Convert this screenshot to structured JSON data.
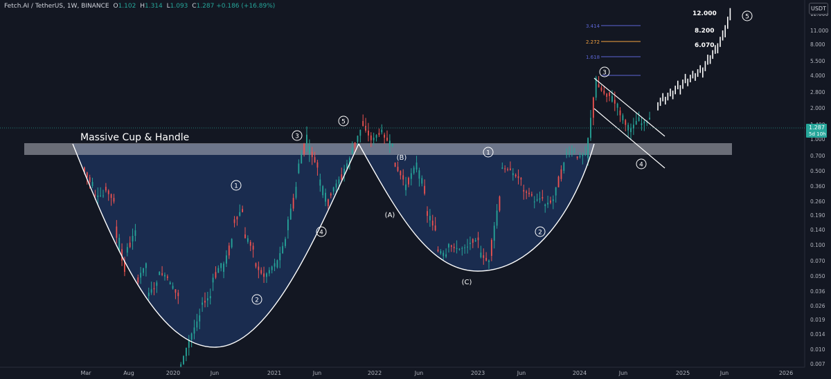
{
  "header": {
    "symbol": "Fetch.AI / TetherUS, 1W, BINANCE",
    "o_label": "O",
    "o_value": "1.102",
    "h_label": "H",
    "h_value": "1.314",
    "l_label": "L",
    "l_value": "1.093",
    "c_label": "C",
    "c_value": "1.287",
    "change": "+0.186 (+16.89%)"
  },
  "currency": "USDT",
  "colors": {
    "background": "#131722",
    "up": "#26a69a",
    "down": "#ef5350",
    "cup_fill": "#1c3057",
    "zone": "#b2b5be",
    "text": "#d1d4dc",
    "line": "#ffffff"
  },
  "chart_data": {
    "type": "candlestick",
    "title": "Massive Cup & Handle",
    "y_scale": "log",
    "y_ticks": [
      "12.000",
      "11.000",
      "8.000",
      "5.500",
      "4.000",
      "2.800",
      "2.000",
      "1.400",
      "1.000",
      "0.700",
      "0.500",
      "0.360",
      "0.260",
      "0.190",
      "0.140",
      "0.100",
      "0.070",
      "0.050",
      "0.036",
      "0.026",
      "0.019",
      "0.014",
      "0.010",
      "0.007"
    ],
    "x_ticks": [
      "Mar",
      "Aug",
      "2020",
      "Jun",
      "2021",
      "Jun",
      "2022",
      "Jun",
      "2023",
      "Jun",
      "2024",
      "Jun",
      "2025",
      "Jun",
      "2026"
    ],
    "last_price": "1.287",
    "countdown": "5d 10h",
    "fib_levels": [
      {
        "label": "3.414",
        "color": "#5d66d6"
      },
      {
        "label": "2.272",
        "color": "#f7a440"
      },
      {
        "label": "1.618",
        "color": "#5d66d6"
      }
    ],
    "targets": [
      "12.000",
      "8.200",
      "6.070"
    ],
    "wave_labels": [
      "1",
      "2",
      "3",
      "4",
      "5",
      "1",
      "2",
      "3",
      "4",
      "5",
      "1",
      "2",
      "3",
      "4",
      "5"
    ],
    "abc_labels": [
      "(A)",
      "(B)",
      "(C)"
    ],
    "price_path": [
      [
        0.45,
        0.3
      ],
      [
        0.25,
        0.25
      ],
      [
        0.3,
        0.22
      ],
      [
        0.13,
        0.05
      ],
      [
        0.075,
        0.12
      ],
      [
        0.04,
        0.06
      ],
      [
        0.03,
        0.04
      ],
      [
        0.05,
        0.044
      ],
      [
        0.04,
        0.03
      ],
      [
        0.006,
        0.012
      ],
      [
        0.012,
        0.02
      ],
      [
        0.025,
        0.03
      ],
      [
        0.04,
        0.06
      ],
      [
        0.05,
        0.1
      ],
      [
        0.14,
        0.19
      ],
      [
        0.11,
        0.08
      ],
      [
        0.06,
        0.045
      ],
      [
        0.045,
        0.06
      ],
      [
        0.055,
        0.1
      ],
      [
        0.12,
        0.3
      ],
      [
        0.4,
        0.9
      ],
      [
        0.7,
        0.45
      ],
      [
        0.35,
        0.2
      ],
      [
        0.25,
        0.35
      ],
      [
        0.35,
        0.55
      ],
      [
        0.6,
        1.0
      ],
      [
        1.2,
        0.8
      ],
      [
        0.8,
        1.0
      ],
      [
        0.9,
        0.7
      ],
      [
        0.5,
        0.35
      ],
      [
        0.28,
        0.45
      ],
      [
        0.5,
        0.26
      ],
      [
        0.18,
        0.12
      ],
      [
        0.08,
        0.07
      ],
      [
        0.09,
        0.08
      ],
      [
        0.08,
        0.085
      ],
      [
        0.09,
        0.1
      ],
      [
        0.075,
        0.06
      ],
      [
        0.07,
        0.25
      ],
      [
        0.45,
        0.42
      ],
      [
        0.4,
        0.35
      ],
      [
        0.28,
        0.25
      ],
      [
        0.22,
        0.24
      ],
      [
        0.2,
        0.23
      ],
      [
        0.25,
        0.5
      ],
      [
        0.6,
        0.65
      ],
      [
        0.55,
        0.6
      ],
      [
        0.55,
        3.0
      ],
      [
        2.6,
        2.0
      ],
      [
        2.2,
        1.6
      ],
      [
        1.5,
        1.0
      ],
      [
        0.95,
        1.3
      ],
      [
        1.1,
        1.287
      ]
    ],
    "projection": [
      [
        1.5,
        2.0
      ],
      [
        1.7,
        2.2
      ],
      [
        1.9,
        2.6
      ],
      [
        2.1,
        3.0
      ],
      [
        2.5,
        3.2
      ],
      [
        2.8,
        3.6
      ],
      [
        3.0,
        4.5
      ],
      [
        4.0,
        5.5
      ],
      [
        5.0,
        7.5
      ],
      [
        7.0,
        12.0
      ]
    ]
  }
}
